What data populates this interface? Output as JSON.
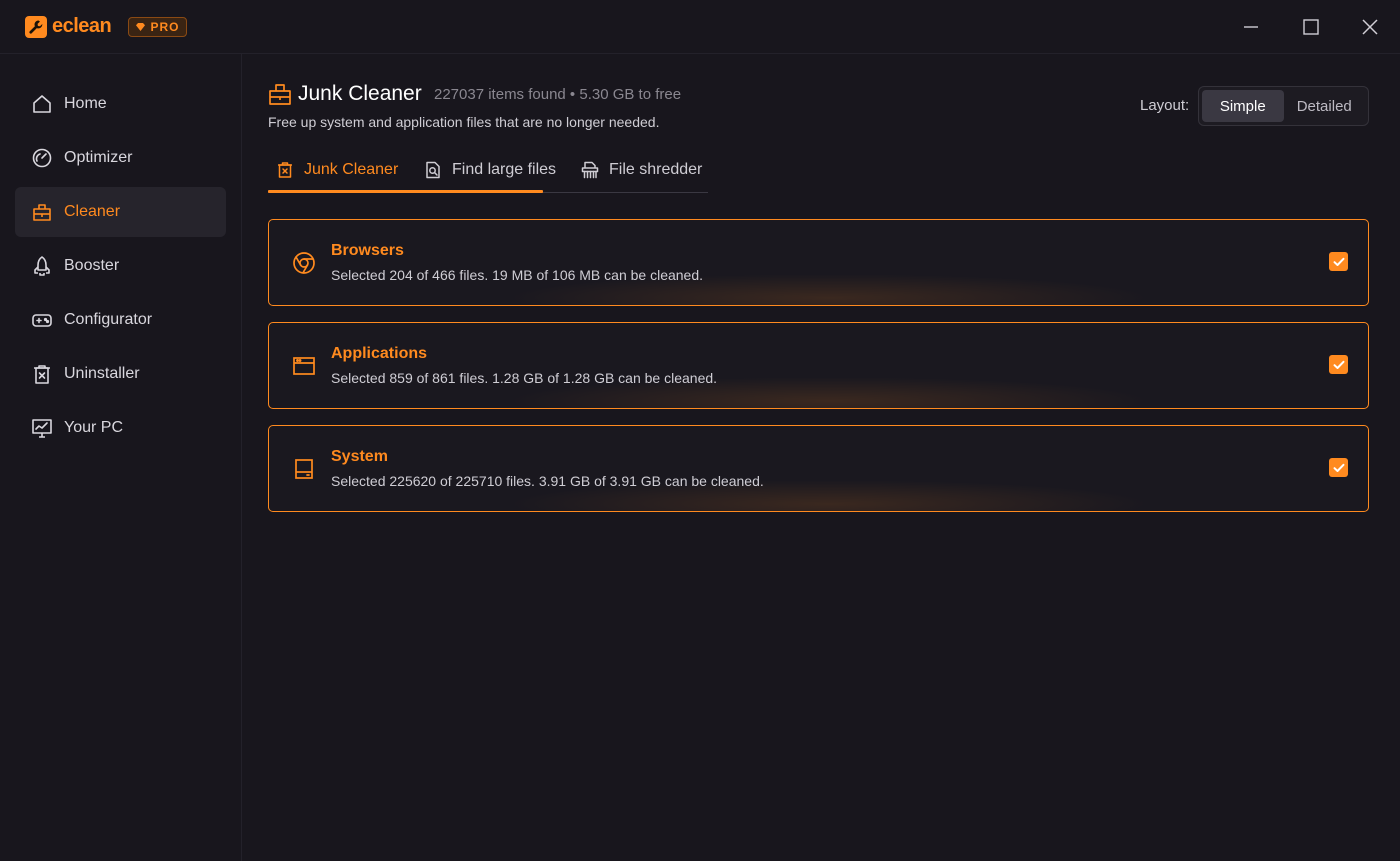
{
  "app": {
    "name": "eclean",
    "badge": "PRO"
  },
  "window": {
    "minimize_icon": "minimize-icon",
    "maximize_icon": "maximize-icon",
    "close_icon": "close-icon"
  },
  "sidebar": {
    "items": [
      {
        "label": "Home",
        "icon": "home-icon"
      },
      {
        "label": "Optimizer",
        "icon": "gauge-icon"
      },
      {
        "label": "Cleaner",
        "icon": "cleaner-icon",
        "active": true
      },
      {
        "label": "Booster",
        "icon": "rocket-icon"
      },
      {
        "label": "Configurator",
        "icon": "gamepad-icon"
      },
      {
        "label": "Uninstaller",
        "icon": "trash-icon"
      },
      {
        "label": "Your PC",
        "icon": "monitor-icon"
      }
    ]
  },
  "header": {
    "title": "Junk Cleaner",
    "meta": "227037 items found • 5.30 GB to free",
    "subtitle": "Free up system and application files that are no longer needed."
  },
  "layout": {
    "label": "Layout:",
    "options": [
      "Simple",
      "Detailed"
    ],
    "selected": "Simple"
  },
  "tabs": [
    {
      "label": "Junk Cleaner",
      "icon": "junk-icon",
      "active": true
    },
    {
      "label": "Find large files",
      "icon": "file-search-icon"
    },
    {
      "label": "File shredder",
      "icon": "shredder-icon"
    }
  ],
  "cards": [
    {
      "title": "Browsers",
      "desc": "Selected 204 of 466 files. 19 MB of 106 MB can be cleaned.",
      "icon": "chrome-icon",
      "checked": true
    },
    {
      "title": "Applications",
      "desc": "Selected 859 of 861 files. 1.28 GB of 1.28 GB can be cleaned.",
      "icon": "window-icon",
      "checked": true
    },
    {
      "title": "System",
      "desc": "Selected 225620 of 225710 files. 3.91 GB of 3.91 GB can be cleaned.",
      "icon": "drive-icon",
      "checked": true
    }
  ],
  "colors": {
    "accent": "#ff8a1f",
    "background": "#18161d",
    "active_nav": "#26242c"
  }
}
